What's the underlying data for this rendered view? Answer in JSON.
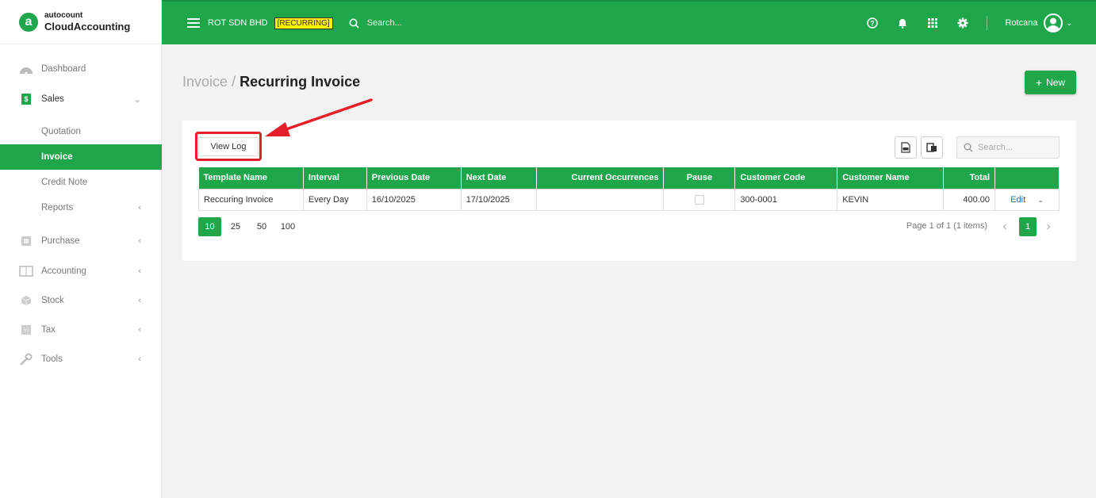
{
  "brand": {
    "top": "autocount",
    "bottom": "CloudAccounting",
    "logo_letter": "a"
  },
  "header": {
    "company": "ROT SDN BHD",
    "tag": "[RECURRING]",
    "search_placeholder": "Search...",
    "user": "Rotcana",
    "icons": [
      "help-icon",
      "bell-icon",
      "apps-grid-icon",
      "gear-icon"
    ]
  },
  "sidebar": {
    "dashboard": "Dashboard",
    "sales": "Sales",
    "quotation": "Quotation",
    "invoice": "Invoice",
    "credit_note": "Credit Note",
    "reports": "Reports",
    "purchase": "Purchase",
    "accounting": "Accounting",
    "stock": "Stock",
    "tax": "Tax",
    "tools": "Tools"
  },
  "page": {
    "breadcrumb": "Invoice",
    "separator": "/",
    "title": "Recurring Invoice",
    "new_button": "New"
  },
  "toolbar": {
    "view_log": "View Log",
    "search_placeholder": "Search..."
  },
  "table": {
    "columns": [
      "Template Name",
      "Interval",
      "Previous Date",
      "Next Date",
      "Current Occurrences",
      "Pause",
      "Customer Code",
      "Customer Name",
      "Total",
      ""
    ],
    "rows": [
      {
        "template_name": "Reccuring Invoice",
        "interval": "Every Day",
        "previous_date": "16/10/2025",
        "next_date": "17/10/2025",
        "current_occurrences": "",
        "pause": false,
        "customer_code": "300-0001",
        "customer_name": "KEVIN",
        "total": "400.00",
        "action": "Edit"
      }
    ]
  },
  "pager": {
    "sizes": [
      "10",
      "25",
      "50",
      "100"
    ],
    "active_size": "10",
    "info": "Page 1 of 1 (1 items)",
    "current_page": "1"
  },
  "colors": {
    "primary": "#1fa64a",
    "highlight": "#e3202a",
    "tag": "#fff200"
  }
}
